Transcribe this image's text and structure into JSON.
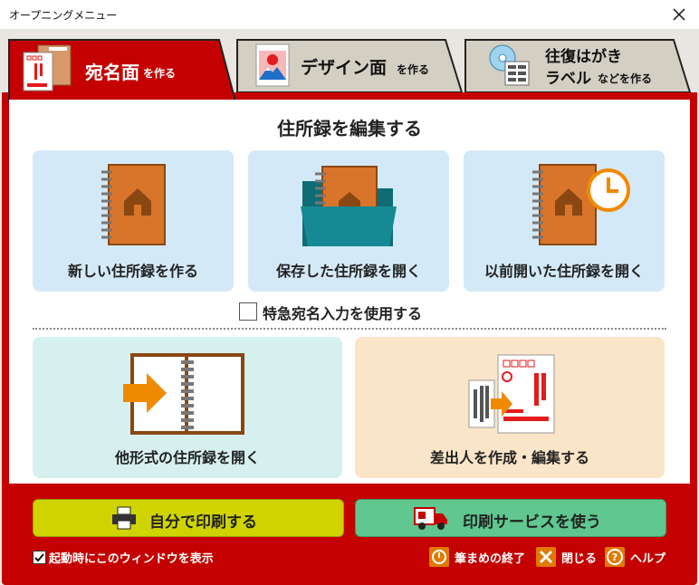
{
  "window": {
    "title": "オープニングメニュー"
  },
  "tabs": [
    {
      "main": "宛名面",
      "sub": "を作る"
    },
    {
      "main": "デザイン面",
      "sub": "を作る"
    },
    {
      "line1": "往復はがき",
      "line2_main": "ラベル",
      "line2_sub": "などを作る"
    }
  ],
  "section_heading": "住所録を編集する",
  "cards": {
    "new": "新しい住所録を作る",
    "open_saved": "保存した住所録を開く",
    "open_recent": "以前開いた住所録を開く",
    "open_other": "他形式の住所録を開く",
    "sender": "差出人を作成・編集する"
  },
  "special_input": {
    "label": "特急宛名入力を使用する",
    "checked": false
  },
  "buttons": {
    "print_self": "自分で印刷する",
    "print_service": "印刷サービスを使う"
  },
  "footer": {
    "show_on_start": "起動時にこのウィンドウを表示",
    "show_on_start_checked": true,
    "quit": "筆まめの終了",
    "close": "閉じる",
    "help": "ヘルプ"
  },
  "colors": {
    "brand_red": "#c40000",
    "card_blue": "#d4e9f7",
    "card_teal": "#d5f0ef",
    "card_peach": "#fbe5c8",
    "btn_yellow": "#cfd400",
    "btn_green": "#5fc78f",
    "orange": "#e07a00"
  }
}
